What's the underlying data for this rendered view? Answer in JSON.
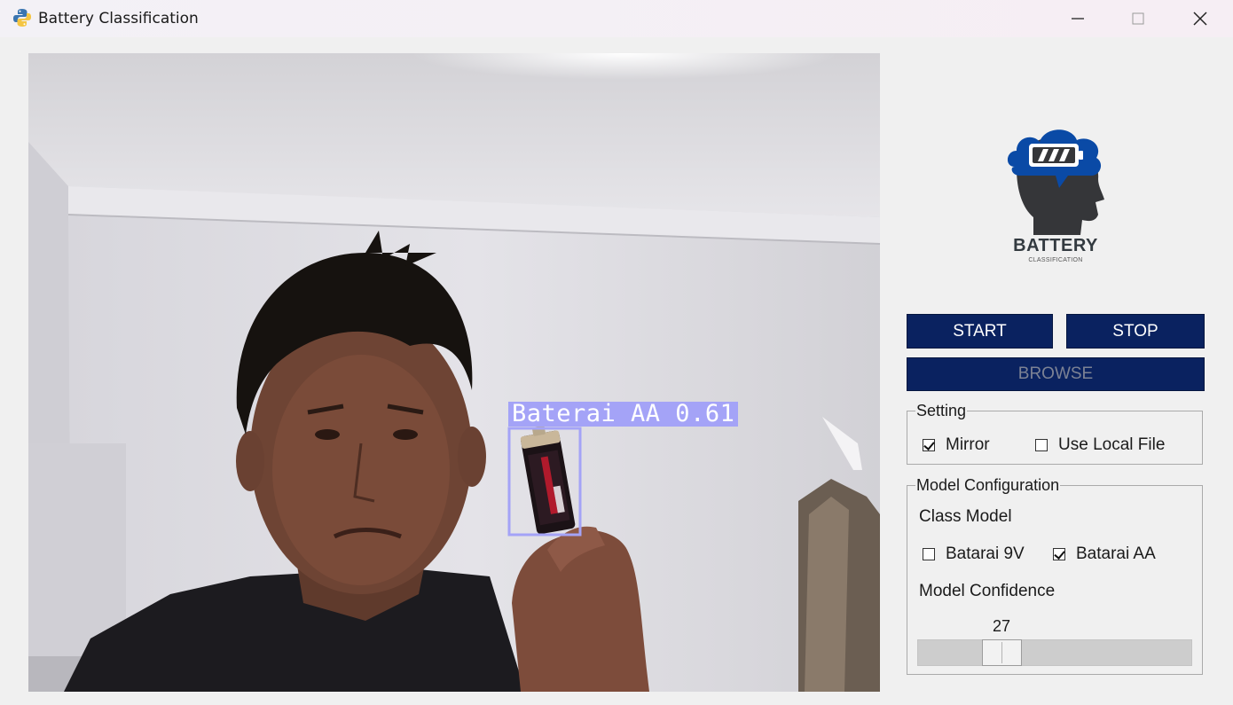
{
  "window": {
    "title": "Battery Classification",
    "icon": "python-icon",
    "controls": [
      "minimize-icon",
      "maximize-icon",
      "close-icon"
    ]
  },
  "feed": {
    "detection_label": "Baterai AA 0.61",
    "box_color": "#a4a3f7"
  },
  "logo": {
    "title": "BATTERY",
    "subtitle": "CLASSIFICATION",
    "brand_color": "#0a4aa6"
  },
  "buttons": {
    "start": "START",
    "stop": "STOP",
    "browse": "BROWSE"
  },
  "setting": {
    "legend": "Setting",
    "mirror": {
      "label": "Mirror",
      "checked": true
    },
    "use_local_file": {
      "label": "Use Local File",
      "checked": false
    }
  },
  "model_config": {
    "legend": "Model Configuration",
    "class_model_label": "Class Model",
    "classes": [
      {
        "label": "Batarai 9V",
        "checked": false
      },
      {
        "label": "Batarai AA",
        "checked": true
      }
    ],
    "confidence_label": "Model Confidence",
    "confidence_value": "27"
  },
  "colors": {
    "button_bg": "#0a2260",
    "panel_bg": "#f0f0f0"
  }
}
